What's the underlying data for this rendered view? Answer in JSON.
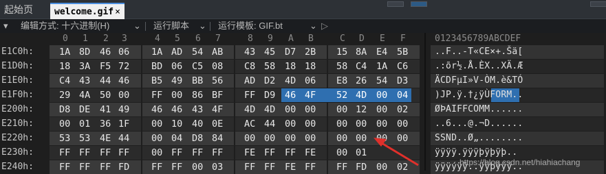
{
  "tabs": {
    "home": "起始页",
    "active": "welcome.gif",
    "close": "×"
  },
  "toolbar": {
    "collapse": "▾",
    "edit_mode": "编辑方式: 十六进制(H)",
    "run_script": "运行脚本",
    "run_template": "运行模板: GIF.bt",
    "dropdown": "⌄",
    "play": "▶",
    "play_ghost": "▷"
  },
  "hex_header": [
    "0",
    "1",
    "2",
    "3",
    "4",
    "5",
    "6",
    "7",
    "8",
    "9",
    "A",
    "B",
    "C",
    "D",
    "E",
    "F"
  ],
  "ascii_header": "0123456789ABCDEF",
  "rows": [
    {
      "addr": "E1C0h:",
      "bytes": [
        "1A",
        "8D",
        "46",
        "06",
        "1A",
        "AD",
        "54",
        "AB",
        "43",
        "45",
        "D7",
        "2B",
        "15",
        "8A",
        "E4",
        "5B"
      ],
      "ascii": "..F..-T«CE×+.Šä["
    },
    {
      "addr": "E1D0h:",
      "bytes": [
        "18",
        "3A",
        "F5",
        "72",
        "BD",
        "06",
        "C5",
        "08",
        "C8",
        "58",
        "18",
        "18",
        "58",
        "C4",
        "1A",
        "C6"
      ],
      "ascii": ".:õr½.Å.ÈX..XÄ.Æ"
    },
    {
      "addr": "E1E0h:",
      "bytes": [
        "C4",
        "43",
        "44",
        "46",
        "B5",
        "49",
        "BB",
        "56",
        "AD",
        "D2",
        "4D",
        "06",
        "E8",
        "26",
        "54",
        "D3"
      ],
      "ascii": "ÄCDFµI»V-ÒM.è&TÓ"
    },
    {
      "addr": "E1F0h:",
      "bytes": [
        "29",
        "4A",
        "50",
        "00",
        "FF",
        "00",
        "86",
        "BF",
        "FF",
        "D9",
        "46",
        "4F",
        "52",
        "4D",
        "00",
        "04"
      ],
      "ascii": ")JP.ÿ.†¿ÿÙFORM.."
    },
    {
      "addr": "E200h:",
      "bytes": [
        "D8",
        "DE",
        "41",
        "49",
        "46",
        "46",
        "43",
        "4F",
        "4D",
        "4D",
        "00",
        "00",
        "00",
        "12",
        "00",
        "02"
      ],
      "ascii": "ØÞAIFFCOMM......"
    },
    {
      "addr": "E210h:",
      "bytes": [
        "00",
        "01",
        "36",
        "1F",
        "00",
        "10",
        "40",
        "0E",
        "AC",
        "44",
        "00",
        "00",
        "00",
        "00",
        "00",
        "00"
      ],
      "ascii": "..6...@.¬D......"
    },
    {
      "addr": "E220h:",
      "bytes": [
        "53",
        "53",
        "4E",
        "44",
        "00",
        "04",
        "D8",
        "84",
        "00",
        "00",
        "00",
        "00",
        "00",
        "00",
        "00",
        "00"
      ],
      "ascii": "SSND..Ø„........"
    },
    {
      "addr": "E230h:",
      "bytes": [
        "FF",
        "FF",
        "FF",
        "FF",
        "00",
        "FF",
        "FF",
        "FF",
        "FE",
        "FF",
        "FF",
        "FE",
        "00",
        "01"
      ],
      "ascii": "ÿÿÿÿ.ÿÿÿþÿþÿþ.."
    },
    {
      "addr": "E240h:",
      "bytes": [
        "FF",
        "FF",
        "FF",
        "FD",
        "FF",
        "FF",
        "00",
        "03",
        "FF",
        "FF",
        "FE",
        "FF",
        "FF",
        "FD",
        "00",
        "02"
      ],
      "ascii": "ÿÿÿýÿÿ..ÿÿþÿÿý.."
    }
  ],
  "selection": {
    "row": 3,
    "start": 10,
    "end": 15,
    "ascii_start": 10,
    "ascii_end": 14
  },
  "watermark": "https://blog.csdn.net/hiahiachang",
  "colors": {
    "selection": "#2f6fb0",
    "accent": "#4a8ede",
    "arrow": "#e0302b"
  }
}
